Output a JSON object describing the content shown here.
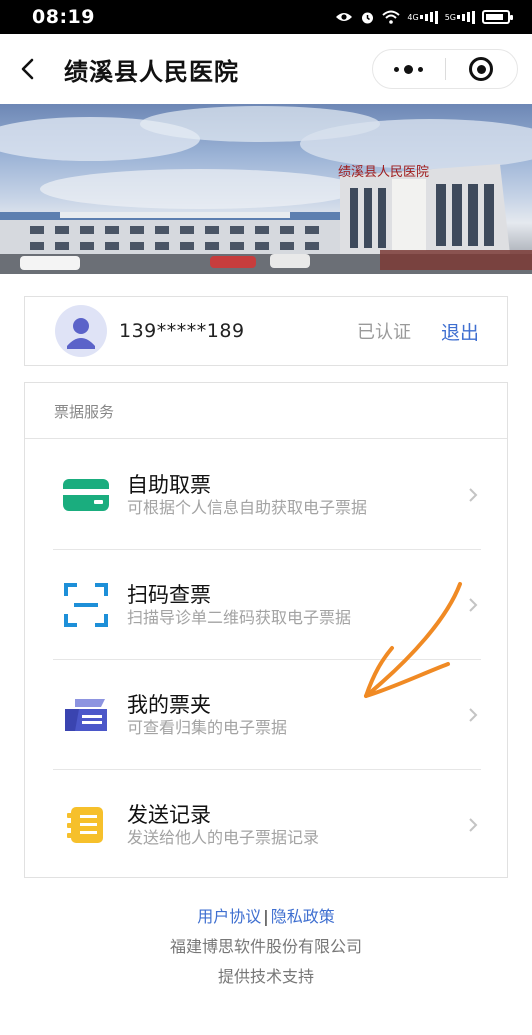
{
  "status_bar": {
    "time": "08:19",
    "net1": "4G",
    "net2": "5G",
    "battery_level": 0.85
  },
  "nav": {
    "title": "绩溪县人民医院",
    "back_icon": "chevron-left-icon",
    "more_icon": "more-dots-icon",
    "close_icon": "target-close-icon"
  },
  "banner": {
    "sign_text": "绩溪县人民医院"
  },
  "user": {
    "phone": "139*****189",
    "status": "已认证",
    "logout_label": "退出",
    "avatar_icon": "user-avatar-icon"
  },
  "services": {
    "header": "票据服务",
    "items": [
      {
        "title": "自助取票",
        "desc": "可根据个人信息自助获取电子票据",
        "icon": "card-icon",
        "color": "#1aad7e"
      },
      {
        "title": "扫码查票",
        "desc": "扫描导诊单二维码获取电子票据",
        "icon": "scan-icon",
        "color": "#1d8fd8"
      },
      {
        "title": "我的票夹",
        "desc": "可查看归集的电子票据",
        "icon": "ticket-folder-icon",
        "color": "#4b57c9"
      },
      {
        "title": "发送记录",
        "desc": "发送给他人的电子票据记录",
        "icon": "list-record-icon",
        "color": "#f6c02b"
      }
    ]
  },
  "footer": {
    "user_agreement": "用户协议",
    "separator": "|",
    "privacy_policy": "隐私政策",
    "company": "福建博思软件股份有限公司",
    "support": "提供技术支持"
  },
  "accent_color": "#3f6fd0",
  "annotation_color": "#f08a24"
}
